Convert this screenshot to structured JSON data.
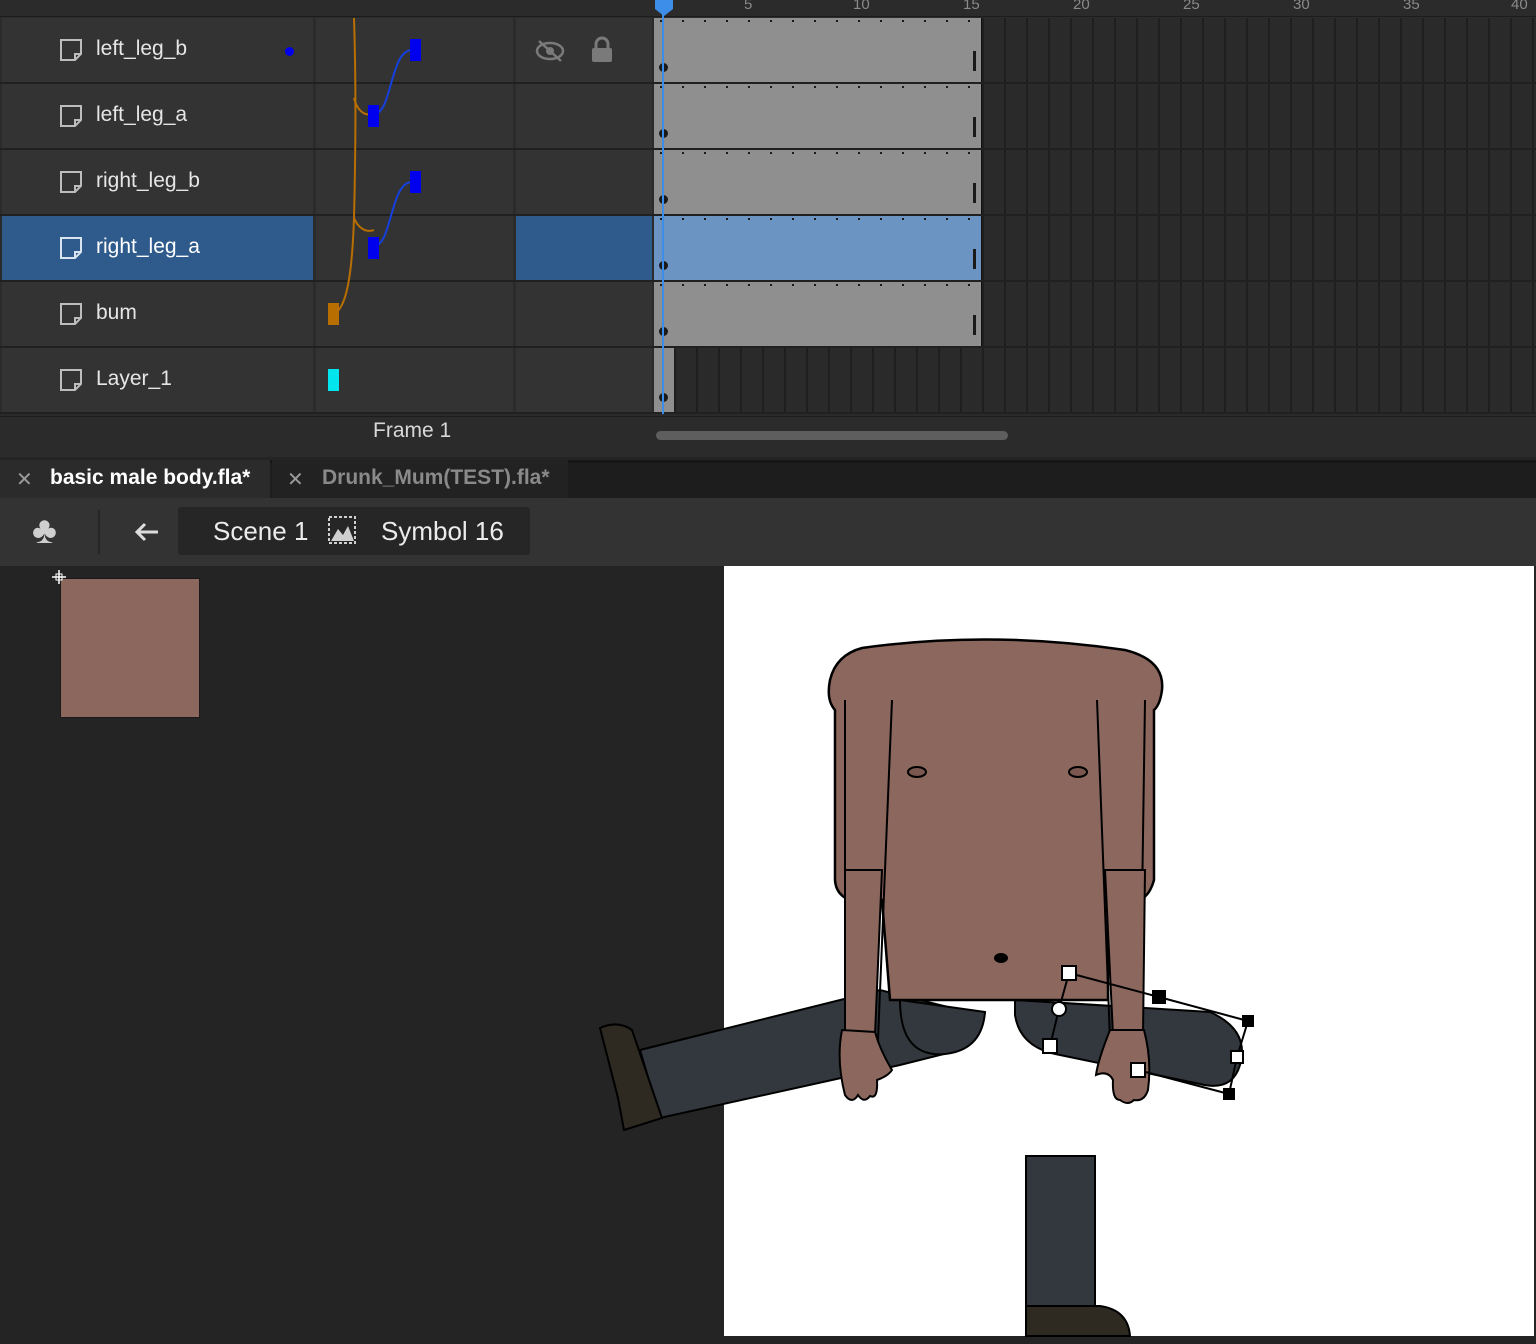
{
  "timeline": {
    "ruler_ticks": [
      "5",
      "10",
      "15",
      "20",
      "25",
      "30",
      "35",
      "40"
    ],
    "layers": [
      {
        "name": "left_leg_b",
        "selected": false,
        "parent_color": "#0000ee"
      },
      {
        "name": "left_leg_a",
        "selected": false,
        "parent_color": "#0000ee"
      },
      {
        "name": "right_leg_b",
        "selected": false,
        "parent_color": "#0000ee"
      },
      {
        "name": "right_leg_a",
        "selected": true,
        "parent_color": "#0000ee"
      },
      {
        "name": "bum",
        "selected": false,
        "parent_color": "#b86e00"
      },
      {
        "name": "Layer_1",
        "selected": false,
        "parent_color": "#00e5ee"
      }
    ],
    "current_frame_label": "Frame 1"
  },
  "document_tabs": [
    {
      "label": "basic male body.fla*",
      "active": true
    },
    {
      "label": "Drunk_Mum(TEST).fla*",
      "active": false
    }
  ],
  "edit_bar": {
    "scene": "Scene 1",
    "symbol": "Symbol 16"
  },
  "colors": {
    "skin": "#8c675e",
    "pants": "#32383e",
    "shoe": "#2e2a22",
    "selection": "#2f5b8c",
    "playhead": "#3d8ee8"
  },
  "icons": [
    "layer-icon",
    "eye-hidden-icon",
    "lock-icon",
    "club-icon",
    "back-arrow-icon",
    "symbol-icon",
    "close-icon"
  ]
}
